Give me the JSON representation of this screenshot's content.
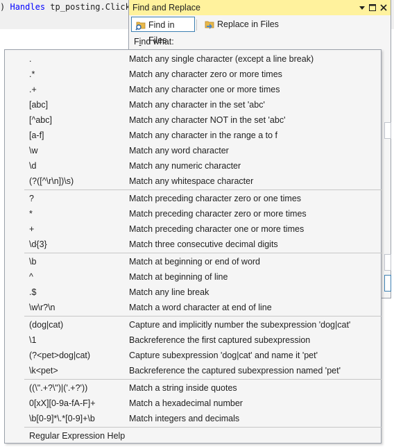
{
  "editor": {
    "code_prefix": ")",
    "code_keyword": "Handles",
    "code_rest": "tp_posting.Click"
  },
  "find_window": {
    "title": "Find and Replace",
    "tabs": [
      {
        "label": "Find in Files",
        "icon": "find-in-files-icon",
        "active": true
      },
      {
        "label": "Replace in Files",
        "icon": "replace-in-files-icon",
        "active": false
      }
    ],
    "find_what_prefix": "F",
    "find_what_mnemonic": "i",
    "find_what_suffix": "nd what:",
    "titlebar_buttons": [
      "dropdown-icon",
      "maximize-icon",
      "close-icon"
    ],
    "titlebar_color": "#fff29d"
  },
  "regex_menu": {
    "groups": [
      [
        {
          "pattern": ".",
          "desc": "Match any single character (except a line break)"
        },
        {
          "pattern": ".*",
          "desc": "Match any character zero or more times"
        },
        {
          "pattern": ".+",
          "desc": "Match any character one or more times"
        },
        {
          "pattern": "[abc]",
          "desc": "Match any character in the set 'abc'"
        },
        {
          "pattern": "[^abc]",
          "desc": "Match any character NOT in the set 'abc'"
        },
        {
          "pattern": "[a-f]",
          "desc": "Match any character in the range a to f"
        },
        {
          "pattern": "\\w",
          "desc": "Match any word character"
        },
        {
          "pattern": "\\d",
          "desc": "Match any numeric character"
        },
        {
          "pattern": "(?([^\\r\\n])\\s)",
          "desc": "Match any whitespace character"
        }
      ],
      [
        {
          "pattern": "?",
          "desc": "Match preceding character zero or one times"
        },
        {
          "pattern": "*",
          "desc": "Match preceding character zero or more times"
        },
        {
          "pattern": "+",
          "desc": "Match preceding character one or more times"
        },
        {
          "pattern": "\\d{3}",
          "desc": "Match three consecutive decimal digits"
        }
      ],
      [
        {
          "pattern": "\\b",
          "desc": "Match at beginning or end of word"
        },
        {
          "pattern": "^",
          "desc": "Match at beginning of line"
        },
        {
          "pattern": ".$",
          "desc": "Match any line break"
        },
        {
          "pattern": "\\w\\r?\\n",
          "desc": "Match a word character at end of line"
        }
      ],
      [
        {
          "pattern": "(dog|cat)",
          "desc": "Capture and implicitly number the subexpression 'dog|cat'"
        },
        {
          "pattern": "\\1",
          "desc": "Backreference the first captured subexpression"
        },
        {
          "pattern": "(?<pet>dog|cat)",
          "desc": "Capture subexpression 'dog|cat' and name it 'pet'"
        },
        {
          "pattern": "\\k<pet>",
          "desc": "Backreference the captured subexpression named 'pet'"
        }
      ],
      [
        {
          "pattern": "((\\\".+?\\\")|('.+?'))",
          "desc": "Match a string inside quotes"
        },
        {
          "pattern": "0[xX][0-9a-fA-F]+",
          "desc": "Match a hexadecimal number"
        },
        {
          "pattern": "\\b[0-9]*\\.*[0-9]+\\b",
          "desc": "Match integers and decimals"
        }
      ]
    ],
    "help_label": "Regular Expression Help"
  }
}
